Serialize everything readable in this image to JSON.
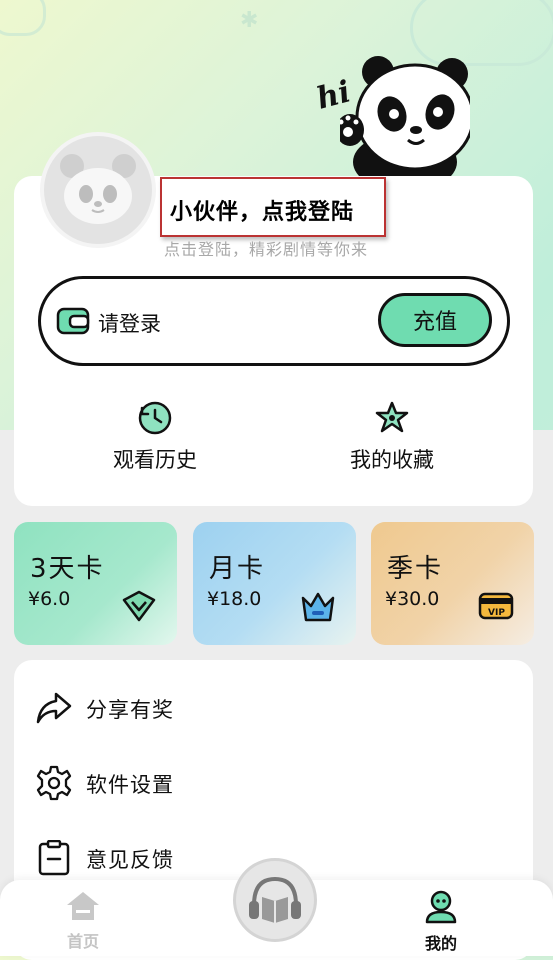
{
  "profile": {
    "title": "小伙伴，点我登陆",
    "subtitle": "点击登陆，精彩剧情等你来",
    "hi": "hi"
  },
  "wallet": {
    "label": "请登录",
    "recharge_label": "充值"
  },
  "quick_links": [
    {
      "label": "观看历史",
      "icon": "history-icon"
    },
    {
      "label": "我的收藏",
      "icon": "favorite-star-icon"
    }
  ],
  "vip_cards": [
    {
      "title": "3天卡",
      "price": "¥6.0",
      "icon": "diamond-icon"
    },
    {
      "title": "月卡",
      "price": "¥18.0",
      "icon": "crown-icon"
    },
    {
      "title": "季卡",
      "price": "¥30.0",
      "icon": "vip-ticket-icon"
    }
  ],
  "menu": [
    {
      "label": "分享有奖",
      "icon": "share-icon"
    },
    {
      "label": "软件设置",
      "icon": "gear-icon"
    },
    {
      "label": "意见反馈",
      "icon": "feedback-clipboard-icon"
    }
  ],
  "tabbar": {
    "home_label": "首页",
    "mine_label": "我的"
  },
  "colors": {
    "accent": "#6fdcb0",
    "card_3day": "#8fe2c0",
    "card_month": "#9dd1f0",
    "card_season": "#efc98f"
  }
}
